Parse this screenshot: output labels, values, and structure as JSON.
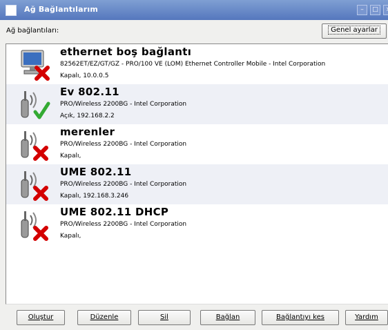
{
  "window": {
    "title": "Ağ Bağlantılarım",
    "min_glyph": "–",
    "max_glyph": "□",
    "close_glyph": "×"
  },
  "header": {
    "label": "Ağ bağlantıları:",
    "settings_button": "Genel ayarlar"
  },
  "connections": [
    {
      "title": "ethernet boş bağlantı",
      "description": "82562ET/EZ/GT/GZ - PRO/100 VE (LOM) Ethernet Controller Mobile - Intel Corporation",
      "status": "Kapalı, 10.0.0.5",
      "icon": "computer-icon",
      "state": "disconnected"
    },
    {
      "title": "Ev 802.11",
      "description": "PRO/Wireless 2200BG - Intel Corporation",
      "status": "Açık, 192.168.2.2",
      "icon": "wireless-icon",
      "state": "connected"
    },
    {
      "title": "merenler",
      "description": "PRO/Wireless 2200BG - Intel Corporation",
      "status": "Kapalı,",
      "icon": "wireless-icon",
      "state": "disconnected"
    },
    {
      "title": "UME 802.11",
      "description": "PRO/Wireless 2200BG - Intel Corporation",
      "status": "Kapalı, 192.168.3.246",
      "icon": "wireless-icon",
      "state": "disconnected"
    },
    {
      "title": "UME 802.11 DHCP",
      "description": "PRO/Wireless 2200BG - Intel Corporation",
      "status": "Kapalı,",
      "icon": "wireless-icon",
      "state": "disconnected"
    }
  ],
  "buttons": {
    "create": "Oluştur",
    "edit": "Düzenle",
    "delete": "Sil",
    "connect": "Bağlan",
    "disconnect": "Bağlantıyı kes",
    "help": "Yardım"
  },
  "colors": {
    "titlebar": "#5577bd",
    "alt_row": "#eef0f6",
    "disconnected": "#d40000",
    "connected": "#33aa33"
  }
}
